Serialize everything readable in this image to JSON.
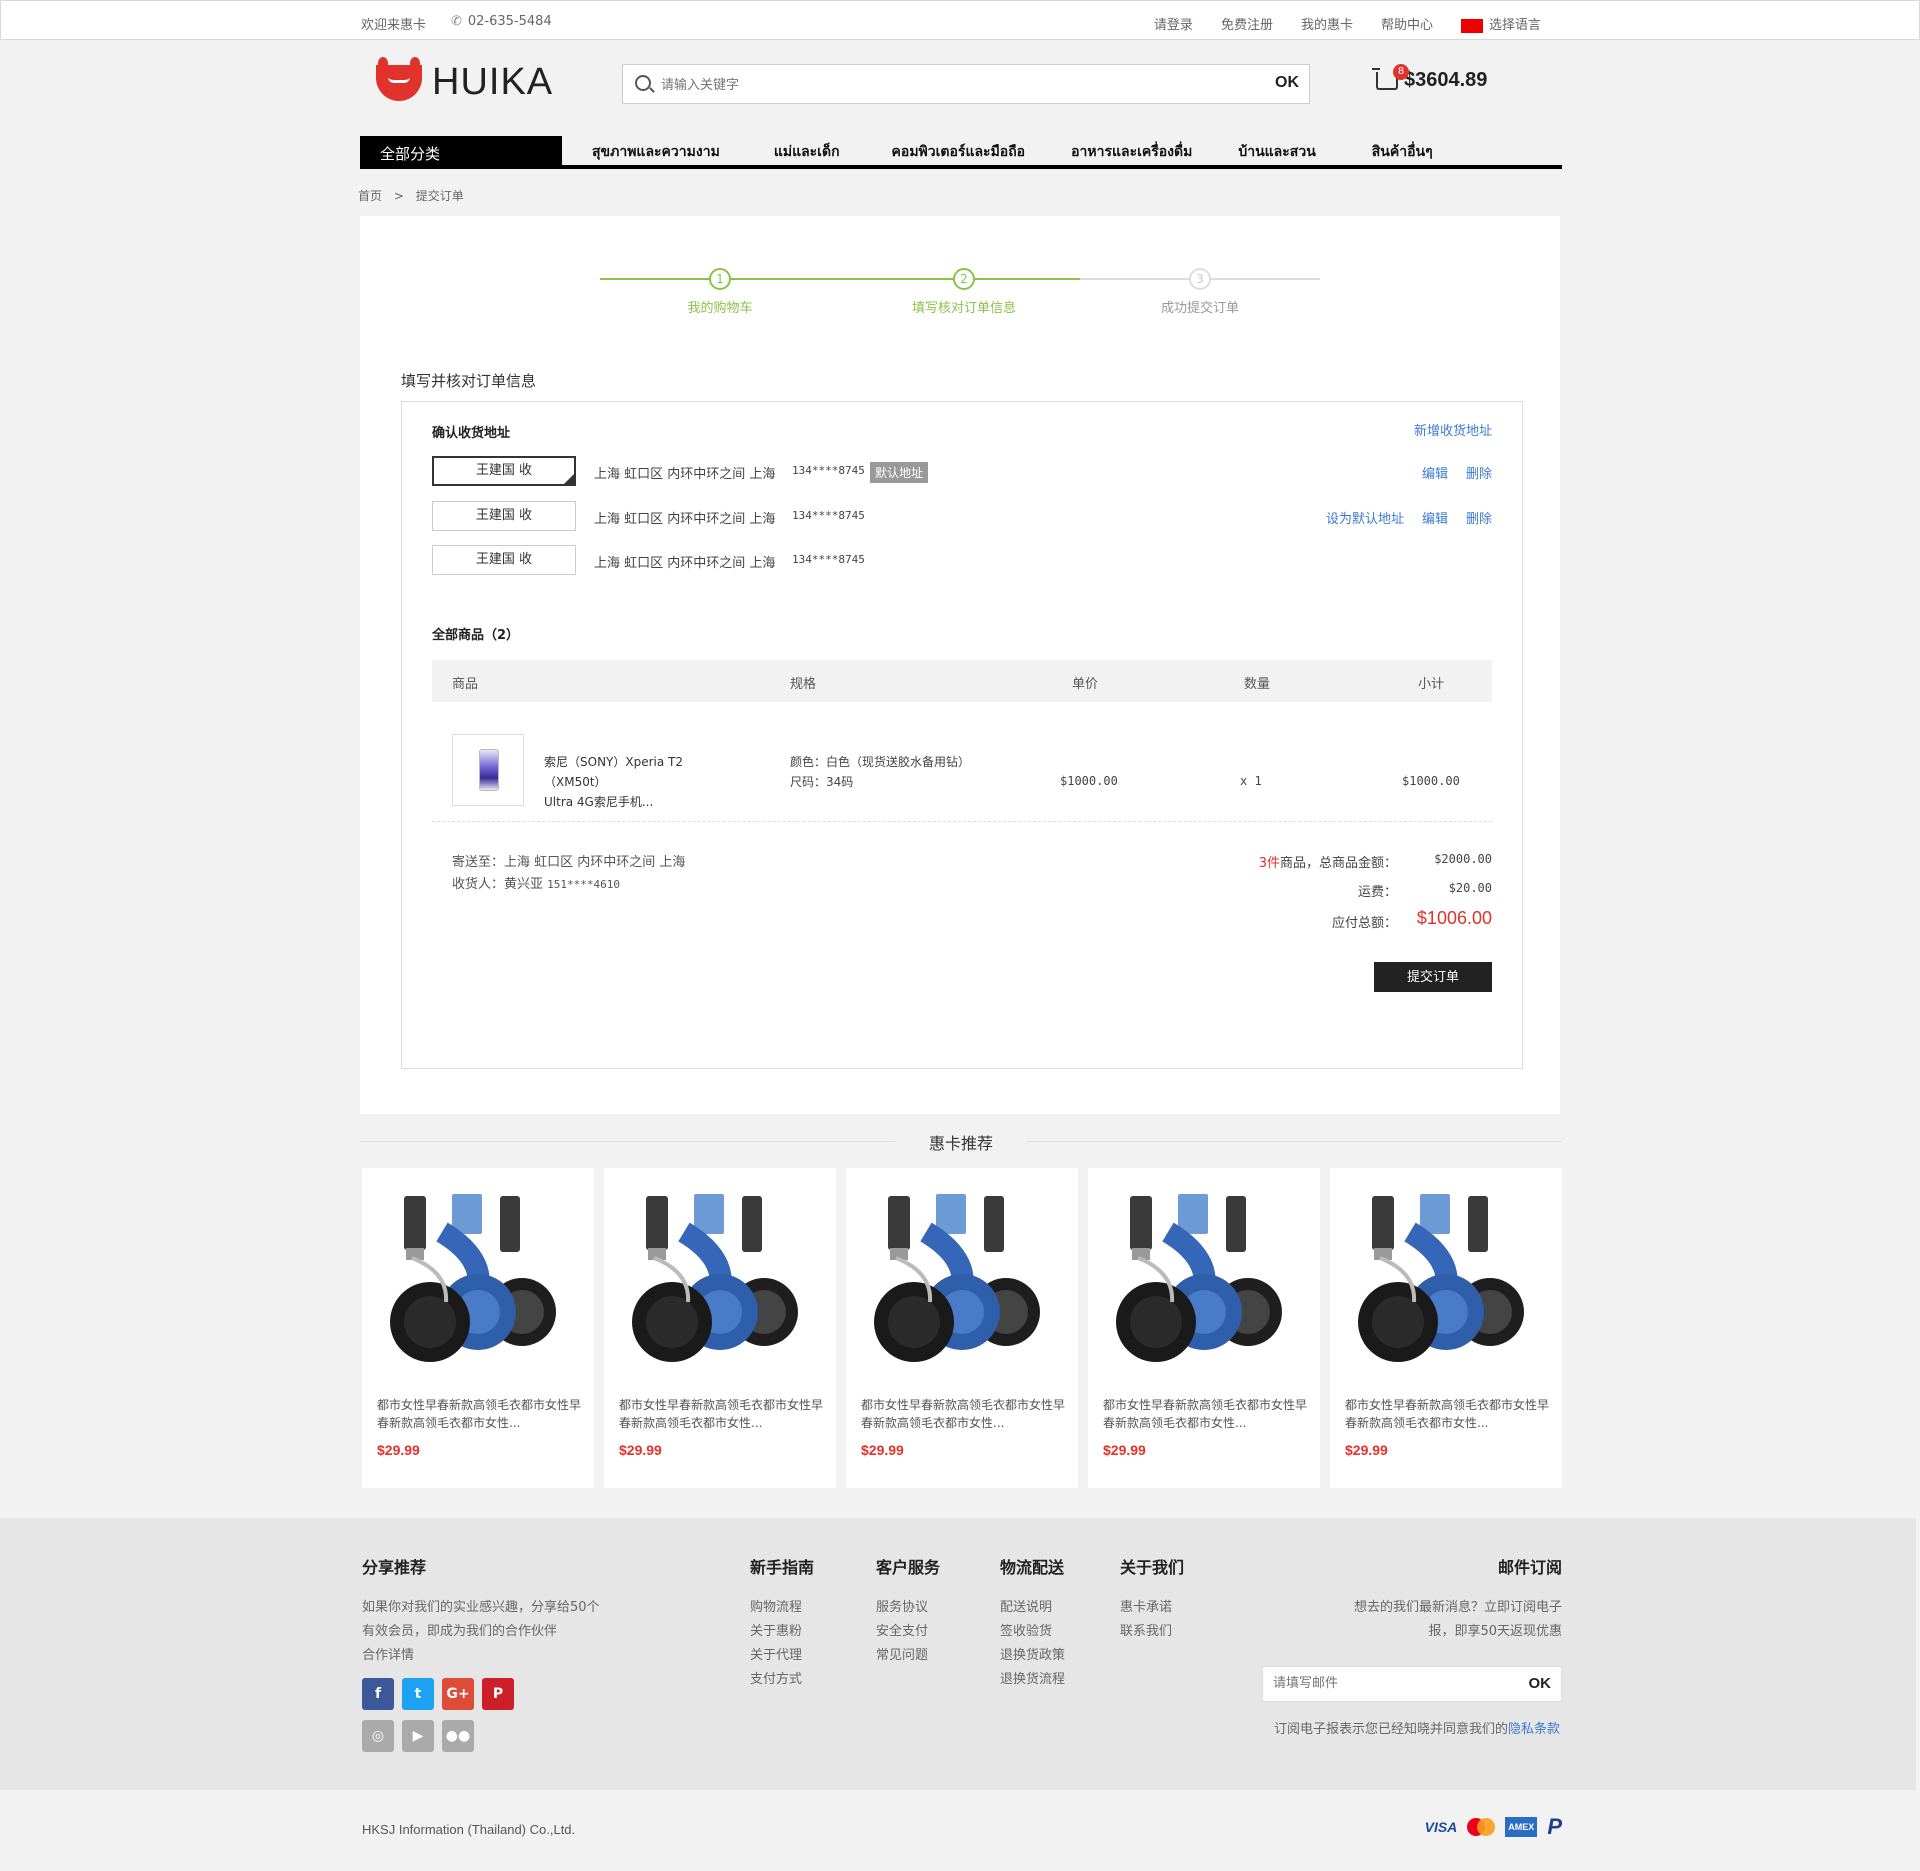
{
  "topbar": {
    "welcome": "欢迎来惠卡",
    "phone": "02-635-5484",
    "links": [
      "请登录",
      "免费注册",
      "我的惠卡",
      "帮助中心"
    ],
    "language": "选择语言"
  },
  "header": {
    "logo_text": "HUIKA",
    "search_placeholder": "请输入关键字",
    "search_button": "OK",
    "cart_count": "8",
    "cart_amount": "$3604.89"
  },
  "nav": {
    "all_categories": "全部分类",
    "items": [
      "สุขภาพและความงาม",
      "แม่และเด็ก",
      "คอมพิวเตอร์และมือถือ",
      "อาหารและเครื่องดื่ม",
      "บ้านและสวน",
      "สินค้าอื่นๆ"
    ]
  },
  "breadcrumb": {
    "home": "首页",
    "sep": ">",
    "current": "提交订单"
  },
  "steps": [
    {
      "num": "1",
      "label": "我的购物车",
      "state": "done"
    },
    {
      "num": "2",
      "label": "填写核对订单信息",
      "state": "done"
    },
    {
      "num": "3",
      "label": "成功提交订单",
      "state": "todo"
    }
  ],
  "order": {
    "title": "填写并核对订单信息",
    "address_section": "确认收货地址",
    "new_address": "新增收货地址",
    "addresses": [
      {
        "name": "王建国  收",
        "address": "上海 虹口区 内环中环之间 上海",
        "phone": "134****8745",
        "is_default": true,
        "default_label": "默认地址",
        "ops": [
          "编辑",
          "删除"
        ]
      },
      {
        "name": "王建国  收",
        "address": "上海 虹口区 内环中环之间 上海",
        "phone": "134****8745",
        "is_default": false,
        "ops": [
          "设为默认地址",
          "编辑",
          "删除"
        ]
      },
      {
        "name": "王建国  收",
        "address": "上海 虹口区 内环中环之间 上海",
        "phone": "134****8745",
        "is_default": false,
        "ops": []
      }
    ],
    "goods_section": "全部商品（2）",
    "table_headers": [
      "商品",
      "规格",
      "单价",
      "数量",
      "小计"
    ],
    "items": [
      {
        "name_line1": "索尼（SONY）Xperia T2（XM50t）",
        "name_line2": "Ultra 4G索尼手机...",
        "spec_line1": "颜色：白色（现货送胶水备用钻）",
        "spec_line2": "尺码：34码",
        "unit_price": "$1000.00",
        "qty": "x 1",
        "subtotal": "$1000.00"
      }
    ],
    "ship_to_label": "寄送至：上海 虹口区 内环中环之间 上海",
    "receiver_label": "收货人：黄兴亚",
    "receiver_phone": "151****4610",
    "summary": {
      "count_num": "3件",
      "count_text": "商品，总商品金额：",
      "goods_total": "$2000.00",
      "shipping_label": "运费：",
      "shipping": "$20.00",
      "payable_label": "应付总额：",
      "payable": "$1006.00"
    },
    "submit": "提交订单"
  },
  "recommend": {
    "title": "惠卡推荐",
    "products": [
      {
        "desc": "都市女性早春新款高领毛衣都市女性早春新款高领毛衣都市女性...",
        "price": "$29.99"
      },
      {
        "desc": "都市女性早春新款高领毛衣都市女性早春新款高领毛衣都市女性...",
        "price": "$29.99"
      },
      {
        "desc": "都市女性早春新款高领毛衣都市女性早春新款高领毛衣都市女性...",
        "price": "$29.99"
      },
      {
        "desc": "都市女性早春新款高领毛衣都市女性早春新款高领毛衣都市女性...",
        "price": "$29.99"
      },
      {
        "desc": "都市女性早春新款高领毛衣都市女性早春新款高领毛衣都市女性...",
        "price": "$29.99"
      }
    ]
  },
  "footer": {
    "share": {
      "title": "分享推荐",
      "lines": [
        "如果你对我们的实业感兴趣，分享给50个",
        "有效会员，即成为我们的合作伙伴",
        "合作详情"
      ]
    },
    "columns": [
      {
        "title": "新手指南",
        "items": [
          "购物流程",
          "关于惠粉",
          "关于代理",
          "支付方式"
        ]
      },
      {
        "title": "客户服务",
        "items": [
          "服务协议",
          "安全支付",
          "常见问题"
        ]
      },
      {
        "title": "物流配送",
        "items": [
          "配送说明",
          "签收验货",
          "退换货政策",
          "退换货流程"
        ]
      },
      {
        "title": "关于我们",
        "items": [
          "惠卡承诺",
          "联系我们"
        ]
      }
    ],
    "newsletter": {
      "title": "邮件订阅",
      "line1": "想去的我们最新消息？立即订阅电子",
      "line2": "报，即享50天返现优惠",
      "placeholder": "请填写邮件",
      "button": "OK",
      "legal": "订阅电子报表示您已经知晓并同意我们的",
      "privacy": "隐私条款"
    },
    "company": "HKSJ Information (Thailand) Co.,Ltd.",
    "payments": [
      "VISA",
      "AMEX"
    ]
  }
}
